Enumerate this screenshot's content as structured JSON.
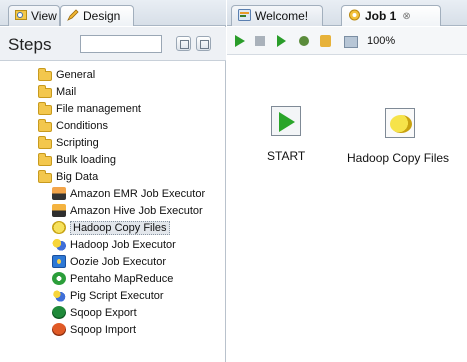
{
  "left_panel": {
    "tabs": [
      {
        "label": "View",
        "icon": "view-icon"
      },
      {
        "label": "Design",
        "icon": "pencil-icon"
      }
    ],
    "steps": {
      "label": "Steps",
      "search_value": "",
      "search_placeholder": ""
    },
    "tree": [
      {
        "label": "General",
        "icon": "folder-icon"
      },
      {
        "label": "Mail",
        "icon": "folder-icon"
      },
      {
        "label": "File management",
        "icon": "folder-icon"
      },
      {
        "label": "Conditions",
        "icon": "folder-icon"
      },
      {
        "label": "Scripting",
        "icon": "folder-icon"
      },
      {
        "label": "Bulk loading",
        "icon": "folder-icon"
      },
      {
        "label": "Big Data",
        "icon": "folder-icon"
      },
      {
        "label": "Amazon EMR Job Executor",
        "icon": "amazon-emr-icon"
      },
      {
        "label": "Amazon Hive Job Executor",
        "icon": "amazon-hive-icon"
      },
      {
        "label": "Hadoop Copy Files",
        "icon": "hadoop-icon",
        "selected": true
      },
      {
        "label": "Hadoop Job Executor",
        "icon": "hadoop-job-icon"
      },
      {
        "label": "Oozie Job Executor",
        "icon": "oozie-icon"
      },
      {
        "label": "Pentaho MapReduce",
        "icon": "mapreduce-icon"
      },
      {
        "label": "Pig Script Executor",
        "icon": "pig-icon"
      },
      {
        "label": "Sqoop Export",
        "icon": "sqoop-export-icon"
      },
      {
        "label": "Sqoop Import",
        "icon": "sqoop-import-icon"
      }
    ]
  },
  "right_panel": {
    "tabs": [
      {
        "label": "Welcome!",
        "icon": "welcome-icon"
      },
      {
        "label": "Job 1",
        "icon": "job-icon",
        "close": "⊗"
      }
    ],
    "toolbar": {
      "zoom": "100%"
    },
    "canvas": {
      "steps": [
        {
          "label": "START",
          "icon": "start-icon"
        },
        {
          "label": "Hadoop Copy Files",
          "icon": "hadoop-copy-files-icon"
        }
      ]
    }
  }
}
